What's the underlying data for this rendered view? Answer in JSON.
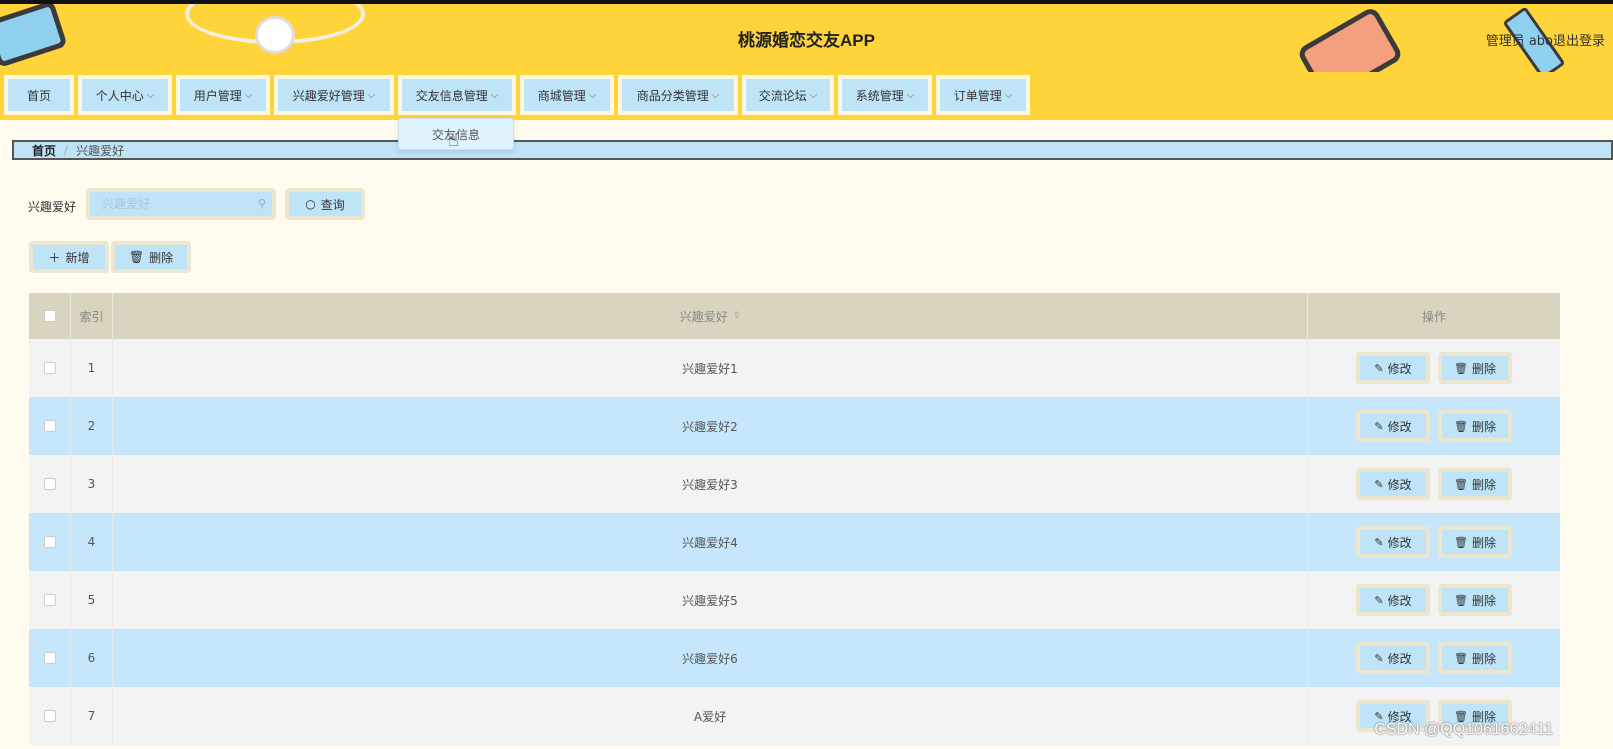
{
  "header": {
    "title": "桃源婚恋交友APP",
    "user": "管理员 abo",
    "logout": "退出登录"
  },
  "nav": {
    "items": [
      {
        "label": "首页",
        "has_dropdown": false
      },
      {
        "label": "个人中心",
        "has_dropdown": true
      },
      {
        "label": "用户管理",
        "has_dropdown": true
      },
      {
        "label": "兴趣爱好管理",
        "has_dropdown": true
      },
      {
        "label": "交友信息管理",
        "has_dropdown": true
      },
      {
        "label": "商城管理",
        "has_dropdown": true
      },
      {
        "label": "商品分类管理",
        "has_dropdown": true
      },
      {
        "label": "交流论坛",
        "has_dropdown": true
      },
      {
        "label": "系统管理",
        "has_dropdown": true
      },
      {
        "label": "订单管理",
        "has_dropdown": true
      }
    ],
    "chevron": "⌵",
    "dropdown_item": "交友信息"
  },
  "breadcrumb": {
    "home": "首页",
    "separator": "/",
    "current": "兴趣爱好"
  },
  "search": {
    "label": "兴趣爱好",
    "placeholder": "兴趣爱好",
    "button": "查询"
  },
  "actions": {
    "add": "新增",
    "delete": "删除"
  },
  "table": {
    "headers": {
      "index": "索引",
      "hobby": "兴趣爱好",
      "ops": "操作"
    },
    "rows": [
      {
        "index": "1",
        "hobby": "兴趣爱好1"
      },
      {
        "index": "2",
        "hobby": "兴趣爱好2"
      },
      {
        "index": "3",
        "hobby": "兴趣爱好3"
      },
      {
        "index": "4",
        "hobby": "兴趣爱好4"
      },
      {
        "index": "5",
        "hobby": "兴趣爱好5"
      },
      {
        "index": "6",
        "hobby": "兴趣爱好6"
      },
      {
        "index": "7",
        "hobby": "A爱好"
      }
    ],
    "edit_label": "修改",
    "delete_label": "删除"
  },
  "watermark": "CSDN @QQ1061662411",
  "colors": {
    "header_bg": "#ffd33a",
    "button_bg": "#bfe3f7",
    "row_alt": "#c6e7fb",
    "row_plain": "#f3f3f3",
    "table_head": "#d9d4c0",
    "page_bg": "#fffbee"
  }
}
